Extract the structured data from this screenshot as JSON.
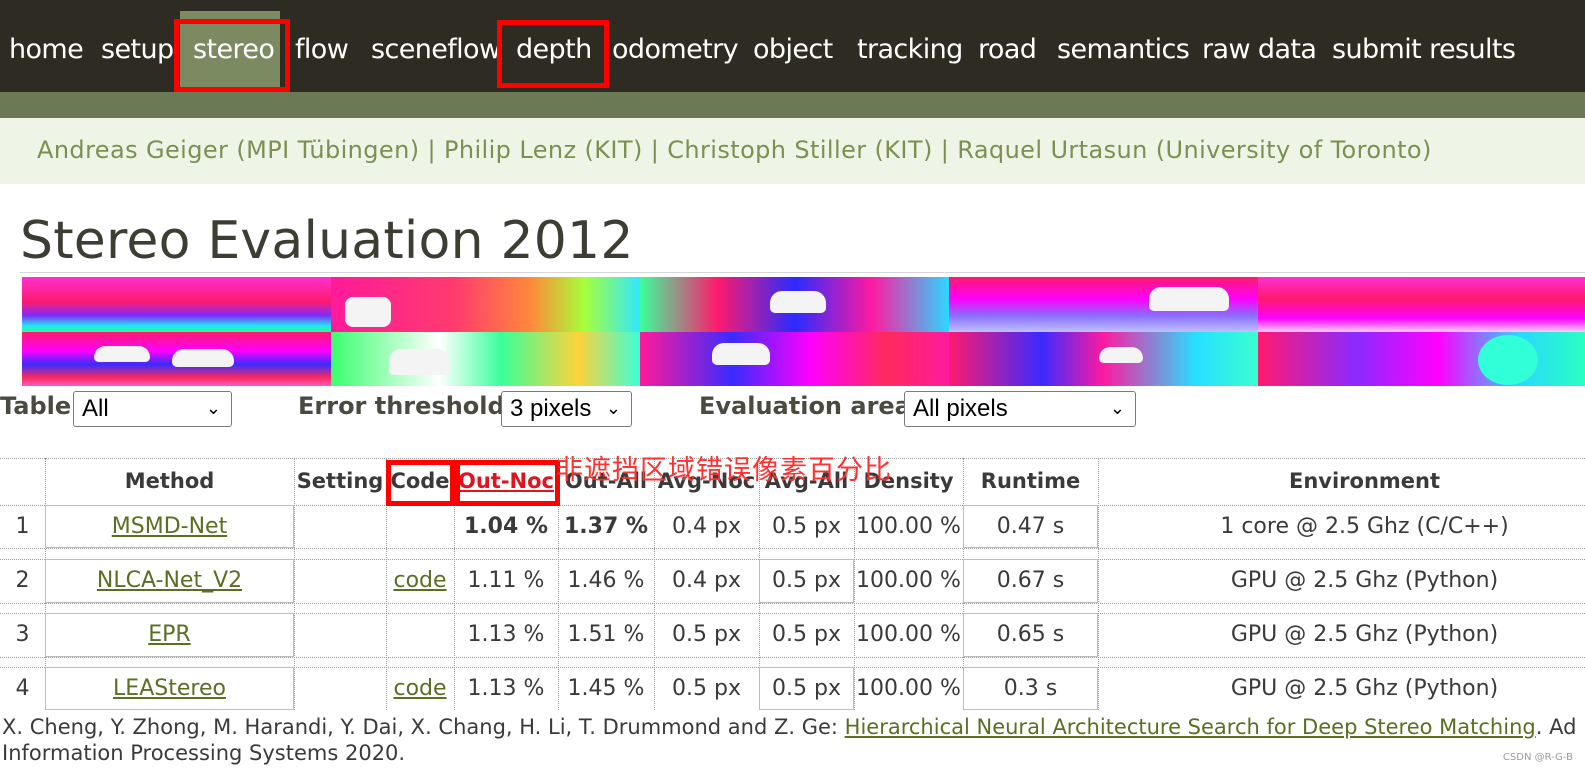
{
  "nav": {
    "items": [
      "home",
      "setup",
      "stereo",
      "flow",
      "sceneflow",
      "depth",
      "odometry",
      "object",
      "tracking",
      "road",
      "semantics",
      "raw data",
      "submit results"
    ],
    "active": "stereo",
    "colors": {
      "bar": "#2e2b22",
      "active": "#7c8a62",
      "stripe": "#6b7a54",
      "highlight_box": "#ff0000"
    }
  },
  "authors": "Andreas Geiger (MPI Tübingen) | Philip Lenz (KIT) | Christoph Stiller (KIT) | Raquel Urtasun (University of Toronto)",
  "page_title": "Stereo Evaluation 2012",
  "controls": {
    "table_label": "Table",
    "table_value": "All",
    "error_label": "Error threshold",
    "error_value": "3 pixels",
    "area_label": "Evaluation area",
    "area_value": "All pixels"
  },
  "annotation": "非遮挡区域错误像素百分比",
  "table": {
    "headers": [
      "Method",
      "Setting",
      "Code",
      "Out-Noc",
      "Out-All",
      "Avg-Noc",
      "Avg-All",
      "Density",
      "Runtime",
      "Environment"
    ],
    "rows": [
      {
        "rank": "1",
        "method": "MSMD-Net",
        "setting": "",
        "code": "",
        "out_noc": "1.04 %",
        "out_all": "1.37 %",
        "avg_noc": "0.4 px",
        "avg_all": "0.5 px",
        "density": "100.00 %",
        "runtime": "0.47 s",
        "environment": "1 core @ 2.5 Ghz (C/C++)"
      },
      {
        "rank": "2",
        "method": "NLCA-Net_V2",
        "setting": "",
        "code": "code",
        "out_noc": "1.11 %",
        "out_all": "1.46 %",
        "avg_noc": "0.4 px",
        "avg_all": "0.5 px",
        "density": "100.00 %",
        "runtime": "0.67 s",
        "environment": "GPU @ 2.5 Ghz (Python)"
      },
      {
        "rank": "3",
        "method": "EPR",
        "setting": "",
        "code": "",
        "out_noc": "1.13 %",
        "out_all": "1.51 %",
        "avg_noc": "0.5 px",
        "avg_all": "0.5 px",
        "density": "100.00 %",
        "runtime": "0.65 s",
        "environment": "GPU @ 2.5 Ghz (Python)"
      },
      {
        "rank": "4",
        "method": "LEAStereo",
        "setting": "",
        "code": "code",
        "out_noc": "1.13 %",
        "out_all": "1.45 %",
        "avg_noc": "0.5 px",
        "avg_all": "0.5 px",
        "density": "100.00 %",
        "runtime": "0.3 s",
        "environment": "GPU @ 2.5 Ghz (Python)"
      }
    ]
  },
  "citation": {
    "prefix": "X. Cheng, Y. Zhong, M. Harandi, Y. Dai, X. Chang, H. Li, T. Drummond and Z. Ge: ",
    "link": "Hierarchical Neural Architecture Search for Deep Stereo Matching",
    "suffix": ". Ad",
    "line2": "Information Processing Systems 2020."
  },
  "watermark": "CSDN @R-G-B"
}
